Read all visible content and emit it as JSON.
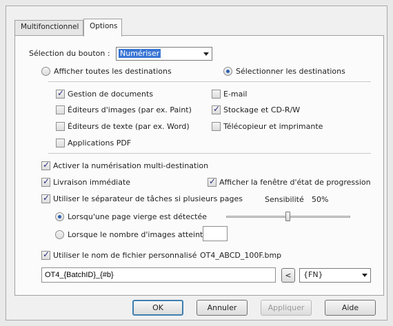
{
  "tabs": [
    {
      "label": "Multifonctionnel",
      "active": false
    },
    {
      "label": "Options",
      "active": true
    }
  ],
  "button_selection": {
    "label": "Sélection du bouton :",
    "value": "Numériser"
  },
  "destination_mode": {
    "show_all_label": "Afficher toutes les destinations",
    "select_label": "Sélectionner les destinations",
    "selected": "select"
  },
  "destinations": [
    {
      "label": "Gestion de documents",
      "checked": true
    },
    {
      "label": "Éditeurs d'images (par ex. Paint)",
      "checked": false
    },
    {
      "label": "Éditeurs de texte (par ex. Word)",
      "checked": false
    },
    {
      "label": "Applications PDF",
      "checked": false
    },
    {
      "label": "E-mail",
      "checked": false
    },
    {
      "label": "Stockage et CD-R/W",
      "checked": true
    },
    {
      "label": "Télécopieur et imprimante",
      "checked": false
    }
  ],
  "options": {
    "multi_destination": {
      "label": "Activer la numérisation multi-destination",
      "checked": true
    },
    "immediate_delivery": {
      "label": "Livraison immédiate",
      "checked": true
    },
    "progress_window": {
      "label": "Afficher la fenêtre d'état de progression",
      "checked": true
    },
    "job_separator": {
      "label": "Utiliser le séparateur de tâches si plusieurs pages",
      "checked": true
    },
    "sensitivity_label": "Sensibilité",
    "sensitivity_value": "50%",
    "sensitivity_fraction": 0.5,
    "blank_page_label": "Lorsqu'une page vierge est détectée",
    "image_count_label": "Lorsque le nombre d'images atteint",
    "separator_mode": "blank",
    "image_count_value": "",
    "custom_filename": {
      "label": "Utiliser le nom de fichier personnalisé",
      "checked": true,
      "example": "OT4_ABCD_100F.bmp"
    },
    "filename_pattern": "OT4_{BatchID}_{#b}",
    "insert_button": "<",
    "token_select": "{FN}"
  },
  "footer": {
    "ok": "OK",
    "cancel": "Annuler",
    "apply": "Appliquer",
    "help": "Aide"
  }
}
